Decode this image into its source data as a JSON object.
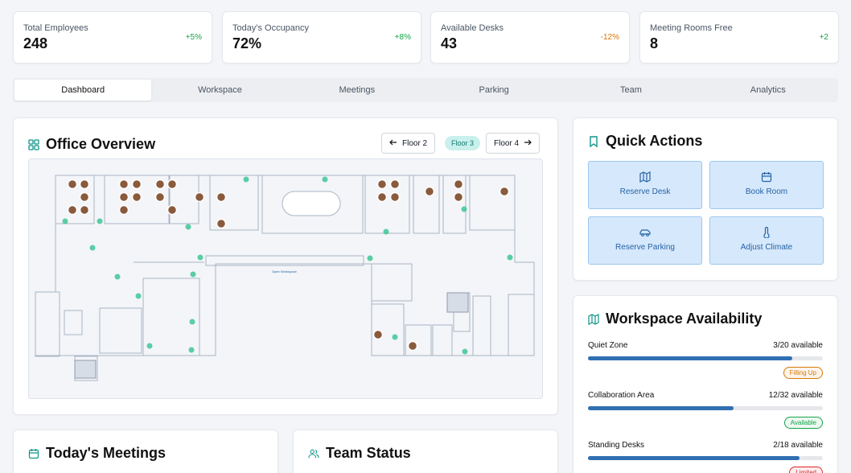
{
  "stats": [
    {
      "label": "Total Employees",
      "value": "248",
      "change": "+5%",
      "trend": "positive"
    },
    {
      "label": "Today's Occupancy",
      "value": "72%",
      "change": "+8%",
      "trend": "positive"
    },
    {
      "label": "Available Desks",
      "value": "43",
      "change": "-12%",
      "trend": "negative"
    },
    {
      "label": "Meeting Rooms Free",
      "value": "8",
      "change": "+2",
      "trend": "positive"
    }
  ],
  "tabs": [
    "Dashboard",
    "Workspace",
    "Meetings",
    "Parking",
    "Team",
    "Analytics"
  ],
  "active_tab": "Dashboard",
  "overview": {
    "title": "Office Overview",
    "floor_prev": "Floor 2",
    "floor_current": "Floor 3",
    "floor_next": "Floor 4",
    "open_workspace_label": "Open Workspace"
  },
  "quick_actions": {
    "title": "Quick Actions",
    "buttons": [
      {
        "label": "Reserve Desk",
        "icon": "map-icon"
      },
      {
        "label": "Book Room",
        "icon": "calendar-icon"
      },
      {
        "label": "Reserve Parking",
        "icon": "car-icon"
      },
      {
        "label": "Adjust Climate",
        "icon": "thermometer-icon"
      }
    ]
  },
  "availability": {
    "title": "Workspace Availability",
    "items": [
      {
        "name": "Quiet Zone",
        "count": "3/20 available",
        "fill": 0.87,
        "status": "Filling Up",
        "status_color": "#d97706"
      },
      {
        "name": "Collaboration Area",
        "count": "12/32 available",
        "fill": 0.62,
        "status": "Available",
        "status_color": "#16a34a"
      },
      {
        "name": "Standing Desks",
        "count": "2/18 available",
        "fill": 0.9,
        "status": "Limited",
        "status_color": "#dc2626"
      }
    ]
  },
  "meetings": {
    "title": "Today's Meetings"
  },
  "team": {
    "title": "Team Status"
  },
  "colors": {
    "accent": "#0f9488",
    "bar": "#2f6fb2",
    "action_bg": "#d6e8fb"
  }
}
